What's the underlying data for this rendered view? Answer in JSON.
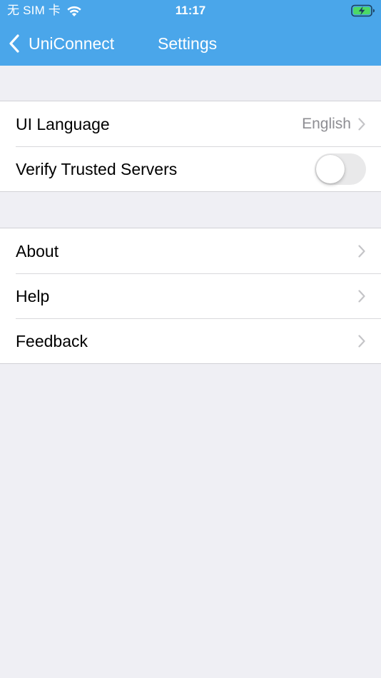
{
  "status_bar": {
    "carrier": "无 SIM 卡",
    "time": "11:17",
    "battery_color": "#4cd964"
  },
  "nav": {
    "back_label": "UniConnect",
    "title": "Settings",
    "background": "#4aa6ea"
  },
  "sections": [
    {
      "rows": [
        {
          "label": "UI Language",
          "value": "English",
          "accessory": "chevron-right-icon"
        },
        {
          "label": "Verify Trusted Servers",
          "accessory": "toggle",
          "toggle_on": false
        }
      ]
    },
    {
      "rows": [
        {
          "label": "About",
          "accessory": "chevron-right-icon"
        },
        {
          "label": "Help",
          "accessory": "chevron-right-icon"
        },
        {
          "label": "Feedback",
          "accessory": "chevron-right-icon"
        }
      ]
    }
  ]
}
